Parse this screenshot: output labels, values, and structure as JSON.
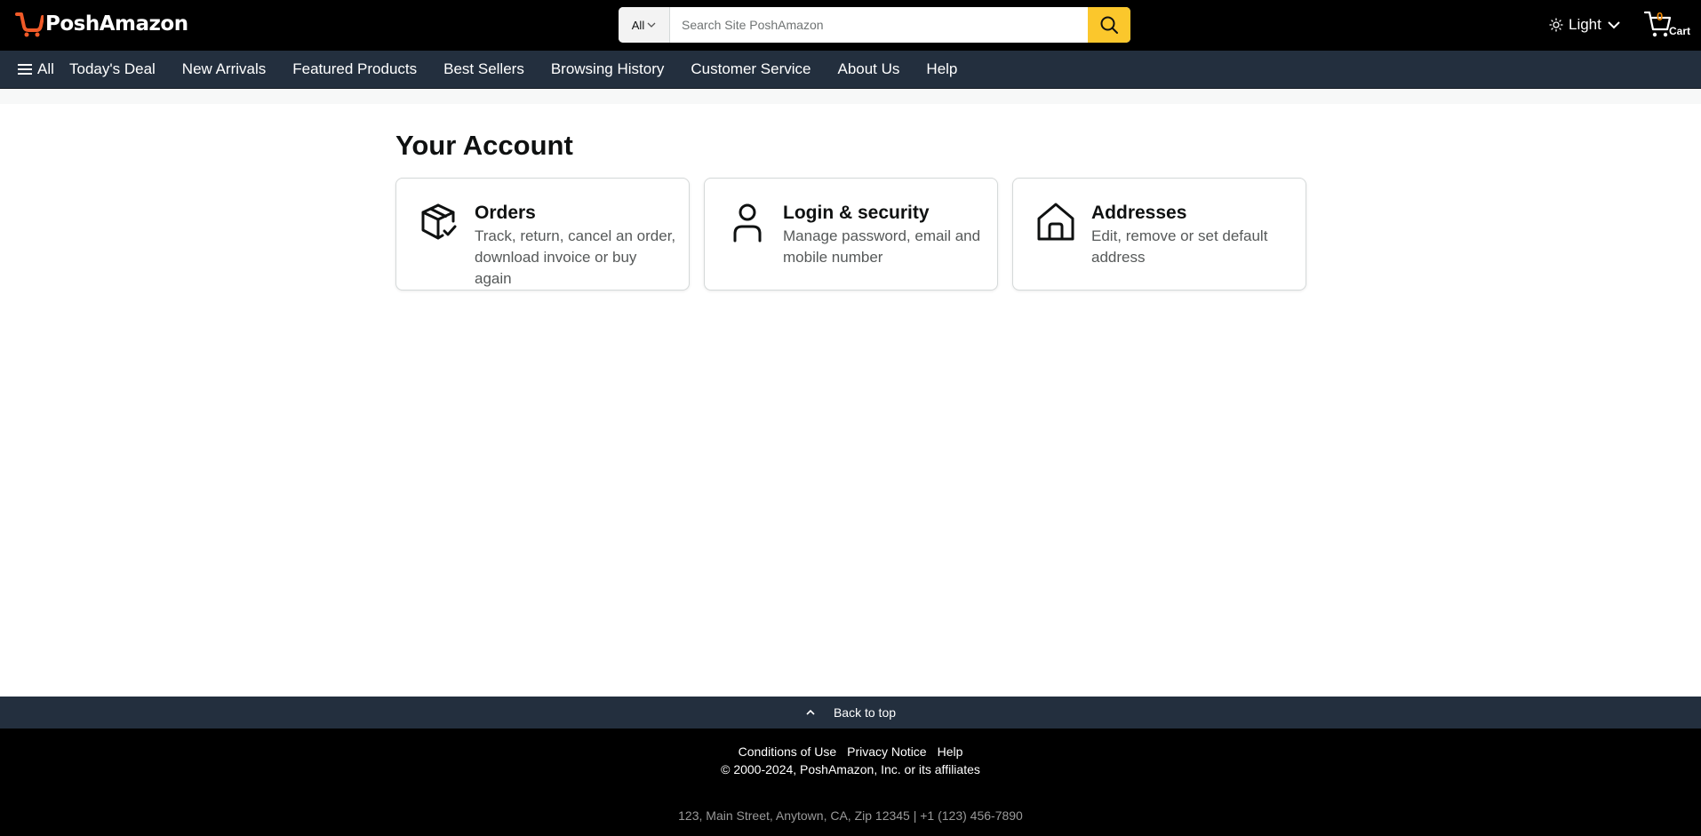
{
  "header": {
    "logo_text": "PoshAmazon",
    "search": {
      "category": "All",
      "placeholder": "Search Site PoshAmazon",
      "value": ""
    },
    "theme_label": "Light",
    "cart": {
      "count": "0",
      "label": "Cart"
    }
  },
  "nav": {
    "all_label": "All",
    "items": [
      {
        "label": "Today's Deal"
      },
      {
        "label": "New Arrivals"
      },
      {
        "label": "Featured Products"
      },
      {
        "label": "Best Sellers"
      },
      {
        "label": "Browsing History"
      },
      {
        "label": "Customer Service"
      },
      {
        "label": "About Us"
      },
      {
        "label": "Help"
      }
    ]
  },
  "main": {
    "title": "Your Account",
    "cards": [
      {
        "title": "Orders",
        "description": "Track, return, cancel an order, download invoice or buy again",
        "icon": "package-check-icon"
      },
      {
        "title": "Login & security",
        "description": "Manage password, email and mobile number",
        "icon": "user-icon"
      },
      {
        "title": "Addresses",
        "description": "Edit, remove or set default address",
        "icon": "home-icon"
      }
    ]
  },
  "footer": {
    "back_to_top": "Back to top",
    "links": [
      {
        "label": "Conditions of Use"
      },
      {
        "label": "Privacy Notice"
      },
      {
        "label": "Help"
      }
    ],
    "copyright": "© 2000-2024, PoshAmazon, Inc. or its affiliates",
    "address": "123, Main Street, Anytown, CA, Zip 12345 | +1 (123) 456-7890"
  },
  "colors": {
    "header_bg": "#000000",
    "nav_bg": "#232f3e",
    "accent": "#fbc72c",
    "cart_count": "#f08804",
    "logo_mark": "#f05a28"
  }
}
